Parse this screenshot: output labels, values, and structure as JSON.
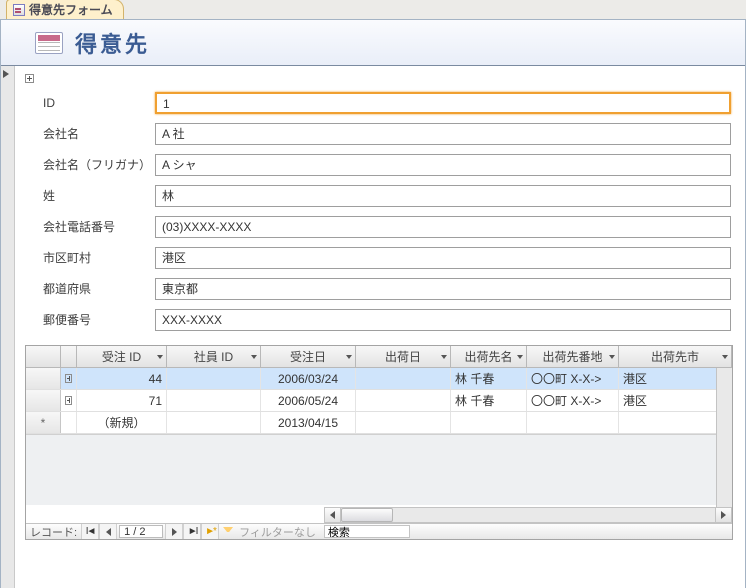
{
  "tab": {
    "label": "得意先フォーム"
  },
  "header": {
    "title": "得意先"
  },
  "fields": {
    "id": {
      "label": "ID",
      "value": "1"
    },
    "company": {
      "label": "会社名",
      "value": "A 社"
    },
    "kana": {
      "label": "会社名（フリガナ）",
      "value": "A シャ"
    },
    "surname": {
      "label": "姓",
      "value": "林"
    },
    "phone": {
      "label": "会社電話番号",
      "value": "(03)XXXX-XXXX"
    },
    "city": {
      "label": "市区町村",
      "value": "港区"
    },
    "pref": {
      "label": "都道府県",
      "value": "東京都"
    },
    "zip": {
      "label": "郵便番号",
      "value": "XXX-XXXX"
    }
  },
  "sub": {
    "columns": {
      "c1": "受注 ID",
      "c2": "社員 ID",
      "c3": "受注日",
      "c4": "出荷日",
      "c5": "出荷先名",
      "c6": "出荷先番地",
      "c7": "出荷先市"
    },
    "rows": [
      {
        "oid": "44",
        "eid": "",
        "odate": "2006/03/24",
        "sdate": "",
        "sname": "林 千春",
        "saddr": "〇〇町 X-X->",
        "scity": "港区"
      },
      {
        "oid": "71",
        "eid": "",
        "odate": "2006/05/24",
        "sdate": "",
        "sname": "林 千春",
        "saddr": "〇〇町 X-X->",
        "scity": "港区"
      }
    ],
    "newrow": {
      "oid": "（新規）",
      "odate": "2013/04/15"
    }
  },
  "nav": {
    "label": "レコード:",
    "position": "1 / 2",
    "filter": "フィルターなし",
    "search": "検索"
  }
}
